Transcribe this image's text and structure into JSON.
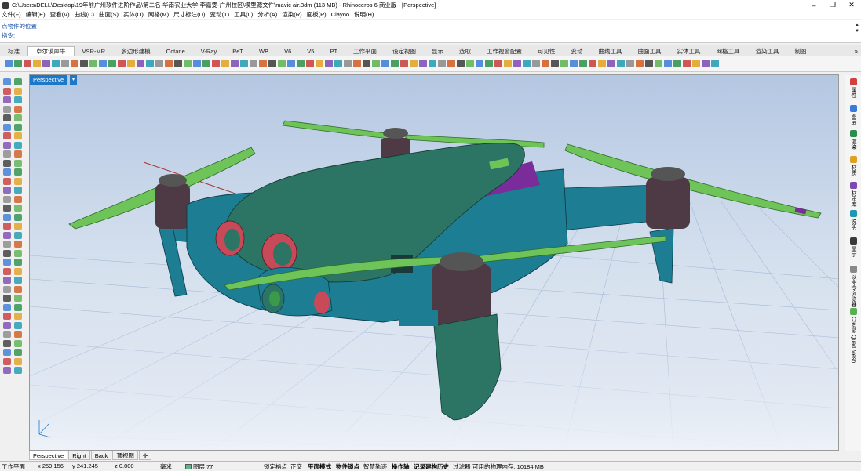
{
  "window": {
    "title": "C:\\Users\\DELL\\Desktop\\19年前广州软件进阶作品\\第二名-华南农业大学-李嘉雯-广州校区\\模型源文件\\mavic air.3dm (113 MB) - Rhinoceros 6 商业版 - [Perspective]",
    "minimize": "–",
    "maximize": "❐",
    "close": "✕"
  },
  "menu": [
    "文件(F)",
    "编辑(E)",
    "查看(V)",
    "曲线(C)",
    "曲面(S)",
    "实体(O)",
    "网格(M)",
    "尺寸标注(D)",
    "变动(T)",
    "工具(L)",
    "分析(A)",
    "渲染(R)",
    "面板(P)",
    "Clayoo",
    "说明(H)"
  ],
  "command": {
    "history": "点物件的位置",
    "prompt": "指令:",
    "value": ""
  },
  "tabs": [
    {
      "label": "标准",
      "active": false
    },
    {
      "label": "卓尔谟犀牛",
      "active": true
    },
    {
      "label": "VSR-MR",
      "active": false
    },
    {
      "label": "多边形建模",
      "active": false
    },
    {
      "label": "Octane",
      "active": false
    },
    {
      "label": "V-Ray",
      "active": false
    },
    {
      "label": "PeT",
      "active": false
    },
    {
      "label": "WB",
      "active": false
    },
    {
      "label": "V6",
      "active": false
    },
    {
      "label": "V5",
      "active": false
    },
    {
      "label": "PT",
      "active": false
    },
    {
      "label": "工作平面",
      "active": false
    },
    {
      "label": "设定视图",
      "active": false
    },
    {
      "label": "显示",
      "active": false
    },
    {
      "label": "选取",
      "active": false
    },
    {
      "label": "工作视窗配置",
      "active": false
    },
    {
      "label": "可见性",
      "active": false
    },
    {
      "label": "变动",
      "active": false
    },
    {
      "label": "曲线工具",
      "active": false
    },
    {
      "label": "曲面工具",
      "active": false
    },
    {
      "label": "实体工具",
      "active": false
    },
    {
      "label": "网格工具",
      "active": false
    },
    {
      "label": "渲染工具",
      "active": false
    },
    {
      "label": "制图",
      "active": false
    }
  ],
  "tabs_more": "»",
  "viewport": {
    "name": "Perspective",
    "menu_glyph": "▾"
  },
  "view_tabs": [
    {
      "label": "Perspective",
      "active": true
    },
    {
      "label": "Right",
      "active": false
    },
    {
      "label": "Back",
      "active": false
    },
    {
      "label": "顶视图",
      "active": false
    },
    {
      "label": "✛",
      "active": false
    }
  ],
  "right_panels": [
    "属性",
    "图层",
    "渲染",
    "材质",
    "材质库",
    "说明",
    "显示",
    "以命令浏览器",
    "Create Quad Mesh"
  ],
  "status": {
    "cplane": "工作平面",
    "x": "x 259.156",
    "y": "y 241.245",
    "z": "z 0.000",
    "unit": "毫米",
    "layer": "图层 77",
    "lock_grid": "锁定格点",
    "ortho": "正交",
    "planar": "平面模式",
    "osnap": "物件锁点",
    "smarttrack": "智慧轨迹",
    "gumball": "操作轴",
    "history": "记录建构历史",
    "filter": "过滤器",
    "memory": "可用的物理内存: 10184 MB"
  },
  "colors": {
    "accent": "#1e78c8",
    "body_teal": "#1d7d93",
    "shell_green": "#2c7565",
    "propeller": "#6ec458",
    "motor": "#4e3a44",
    "lens_red": "#c84a58",
    "strip_purple": "#7a2d9a",
    "layer_swatch": "#5fb38e"
  }
}
